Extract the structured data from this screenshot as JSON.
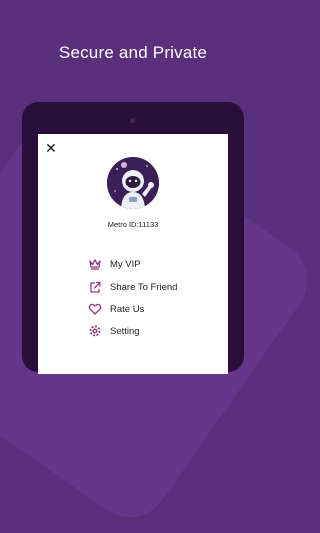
{
  "headline": "Secure and Private",
  "profile": {
    "user_id": "Metro ID:11133"
  },
  "menu": {
    "items": [
      {
        "label": "My VIP",
        "icon": "crown-icon"
      },
      {
        "label": "Share To Friend",
        "icon": "share-icon"
      },
      {
        "label": "Rate Us",
        "icon": "heart-icon"
      },
      {
        "label": "Setting",
        "icon": "gear-icon"
      }
    ]
  },
  "colors": {
    "background": "#5a2f7c",
    "device": "#2a0f3a",
    "accent": "#8b3a7a"
  }
}
